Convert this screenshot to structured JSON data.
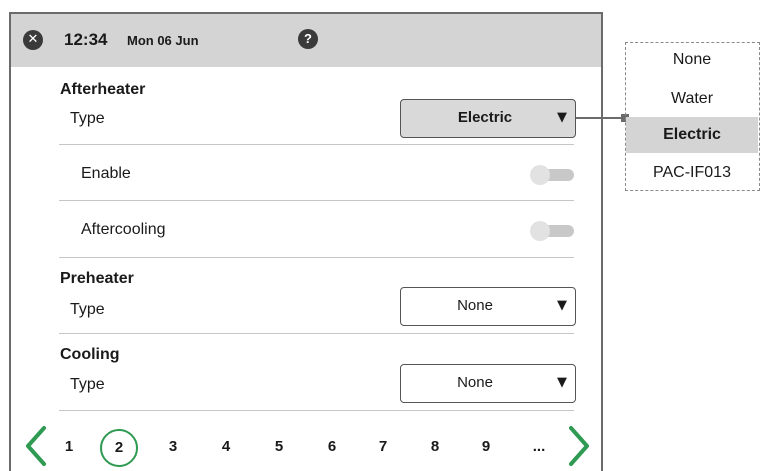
{
  "header": {
    "close_icon": "close-icon",
    "time": "12:34",
    "date": "Mon 06 Jun",
    "help_label": "?"
  },
  "afterheater": {
    "title": "Afterheater",
    "type_label": "Type",
    "type_value": "Electric",
    "enable_label": "Enable",
    "enable_on": false,
    "aftercooling_label": "Aftercooling",
    "aftercooling_on": false
  },
  "preheater": {
    "title": "Preheater",
    "type_label": "Type",
    "type_value": "None"
  },
  "cooling": {
    "title": "Cooling",
    "type_label": "Type",
    "type_value": "None"
  },
  "select_arrow": "▼",
  "pager": {
    "pages": [
      "1",
      "2",
      "3",
      "4",
      "5",
      "6",
      "7",
      "8",
      "9",
      "..."
    ],
    "current": "2"
  },
  "dropdown": {
    "options": [
      "None",
      "Water",
      "Electric",
      "PAC-IF013"
    ],
    "selected": "Electric"
  },
  "colors": {
    "header_bg": "#d4d4d4",
    "accent_green": "#2f9a52",
    "border_dark": "#6b6b6b"
  }
}
